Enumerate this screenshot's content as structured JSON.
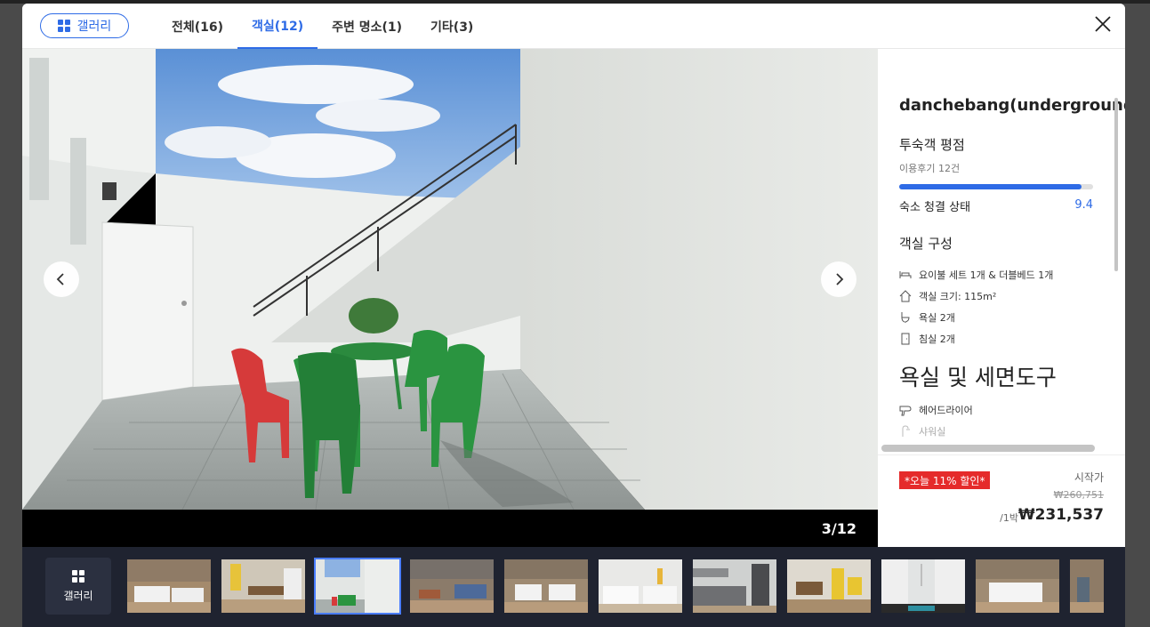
{
  "header": {
    "gallery_label": "갤러리",
    "tabs": [
      {
        "label": "전체(16)"
      },
      {
        "label": "객실(12)"
      },
      {
        "label": "주변 명소(1)"
      },
      {
        "label": "기타(3)"
      }
    ],
    "active_tab": "객실(12)"
  },
  "viewer": {
    "counter": "3/12",
    "current_index": 3,
    "total": 12
  },
  "info": {
    "hotel_name": "danchebang(underground",
    "rating_title": "투숙객 평점",
    "review_count": "이용후기 12건",
    "cleanliness_label": "숙소 청결 상태",
    "cleanliness_score": "9.4",
    "cleanliness_fraction": 0.94,
    "room_title": "객실 구성",
    "room_features": [
      {
        "icon": "bed-icon",
        "label": "요이불 세트 1개 & 더블베드 1개"
      },
      {
        "icon": "house-icon",
        "label": "객실 크기: 115m²"
      },
      {
        "icon": "toilet-icon",
        "label": "욕실 2개"
      },
      {
        "icon": "door-icon",
        "label": "침실 2개"
      }
    ],
    "bath_title": "욕실 및 세면도구",
    "bath_features": [
      {
        "icon": "hairdryer-icon",
        "label": "헤어드라이어"
      },
      {
        "icon": "shower-icon",
        "label": "샤워실"
      }
    ]
  },
  "price": {
    "badge": "*오늘 11% 할인*",
    "start_label": "시작가",
    "original": "₩260,751",
    "per_night": "/1박",
    "final": "₩231,537"
  },
  "filmstrip": {
    "gallery_label": "갤러리"
  },
  "colors": {
    "accent": "#2e6be6",
    "sale": "#e52b2b",
    "filmstrip_bg": "#1f2330"
  }
}
